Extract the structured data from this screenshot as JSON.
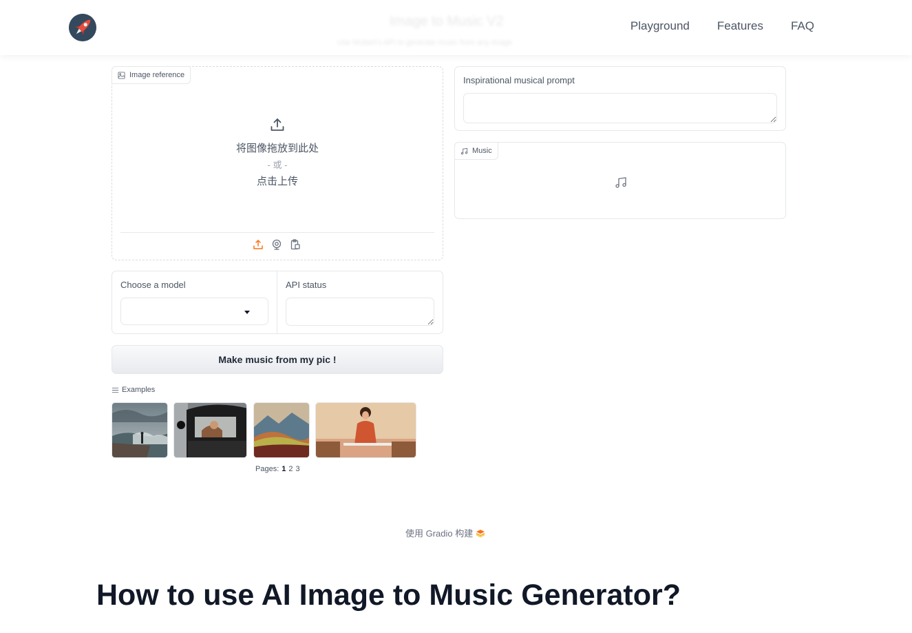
{
  "header": {
    "ghost_title": "Image to Music V2",
    "ghost_subtitle": "Use Mubert's API to generate music from any image",
    "nav": [
      "Playground",
      "Features",
      "FAQ"
    ]
  },
  "image_input": {
    "tag_label": "Image reference",
    "drop_text": "将图像拖放到此处",
    "or_text": "- 或 -",
    "click_text": "点击上传"
  },
  "prompt_box": {
    "label": "Inspirational musical prompt",
    "value": ""
  },
  "music_box": {
    "tag_label": "Music"
  },
  "model_select": {
    "label": "Choose a model",
    "value": ""
  },
  "api_status": {
    "label": "API status",
    "value": ""
  },
  "action_button": "Make music from my pic !",
  "examples": {
    "label": "Examples",
    "pages_label": "Pages:",
    "pages": [
      "1",
      "2",
      "3"
    ],
    "current_page": "1"
  },
  "footer": {
    "text": "使用 Gradio 构建"
  },
  "section": {
    "title": "How to use AI Image to Music Generator?"
  },
  "colors": {
    "accent_orange": "#f97316",
    "logo_bg": "#34495e",
    "rocket_red": "#e74c3c"
  }
}
